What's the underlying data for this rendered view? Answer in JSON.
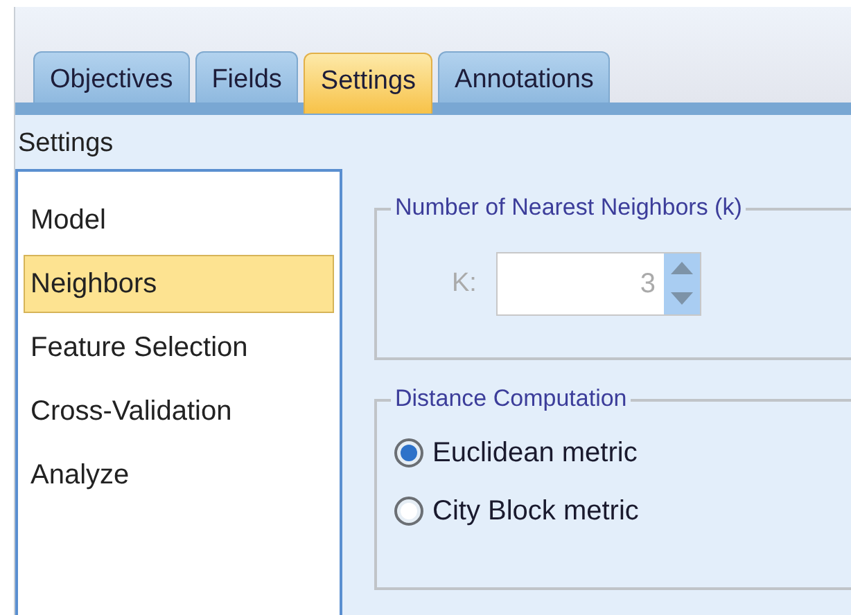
{
  "tabs": [
    {
      "label": "Objectives",
      "selected": false
    },
    {
      "label": "Fields",
      "selected": false
    },
    {
      "label": "Settings",
      "selected": true
    },
    {
      "label": "Annotations",
      "selected": false
    }
  ],
  "section_title": "Settings",
  "sidebar": {
    "items": [
      {
        "label": "Model",
        "selected": false
      },
      {
        "label": "Neighbors",
        "selected": true
      },
      {
        "label": "Feature Selection",
        "selected": false
      },
      {
        "label": "Cross-Validation",
        "selected": false
      },
      {
        "label": "Analyze",
        "selected": false
      }
    ]
  },
  "neighbors_group": {
    "title": "Number of Nearest Neighbors (k)",
    "field_label": "K:",
    "value": "3",
    "disabled": true
  },
  "distance_group": {
    "title": "Distance Computation",
    "options": [
      {
        "label": "Euclidean metric",
        "selected": true
      },
      {
        "label": "City Block metric",
        "selected": false
      }
    ]
  }
}
